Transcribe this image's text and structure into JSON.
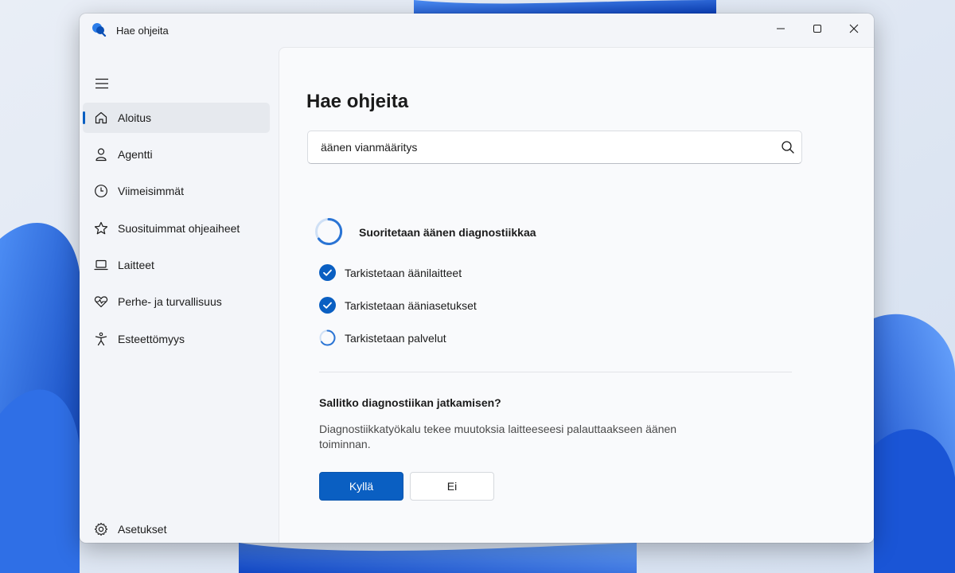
{
  "window": {
    "title": "Hae ohjeita",
    "app_icon": "get-help-icon",
    "controls": [
      "minimize-icon",
      "maximize-icon",
      "close-icon"
    ]
  },
  "sidebar": {
    "menu_icon": "hamburger-icon",
    "items": [
      {
        "label": "Aloitus",
        "icon": "home-icon",
        "active": true
      },
      {
        "label": "Agentti",
        "icon": "person-icon"
      },
      {
        "label": "Viimeisimmät",
        "icon": "clock-icon"
      },
      {
        "label": "Suosituimmat ohjeaiheet",
        "icon": "star-icon"
      },
      {
        "label": "Laitteet",
        "icon": "laptop-icon"
      },
      {
        "label": "Perhe- ja turvallisuus",
        "icon": "heart-pulse-icon"
      },
      {
        "label": "Esteettömyys",
        "icon": "accessibility-icon"
      }
    ],
    "settings": {
      "label": "Asetukset",
      "icon": "gear-icon"
    }
  },
  "main": {
    "title": "Hae ohjeita",
    "search": {
      "value": "äänen vianmääritys",
      "icon": "search-icon"
    },
    "status": {
      "label": "Suoritetaan äänen diagnostiikkaa",
      "icon": "spinner-icon"
    },
    "checks": [
      {
        "label": "Tarkistetaan äänilaitteet",
        "state": "done"
      },
      {
        "label": "Tarkistetaan ääniasetukset",
        "state": "done"
      },
      {
        "label": "Tarkistetaan palvelut",
        "state": "in-progress"
      }
    ],
    "prompt": {
      "question": "Sallitko diagnostiikan jatkamisen?",
      "description": "Diagnostiikkatyökalu tekee muutoksia laitteeseesi palauttaakseen äänen toiminnan.",
      "yes_label": "Kyllä",
      "no_label": "Ei"
    }
  },
  "colors": {
    "accent": "#0a5fc2",
    "background": "#f9fafc",
    "sidebar": "#f3f5f9"
  }
}
